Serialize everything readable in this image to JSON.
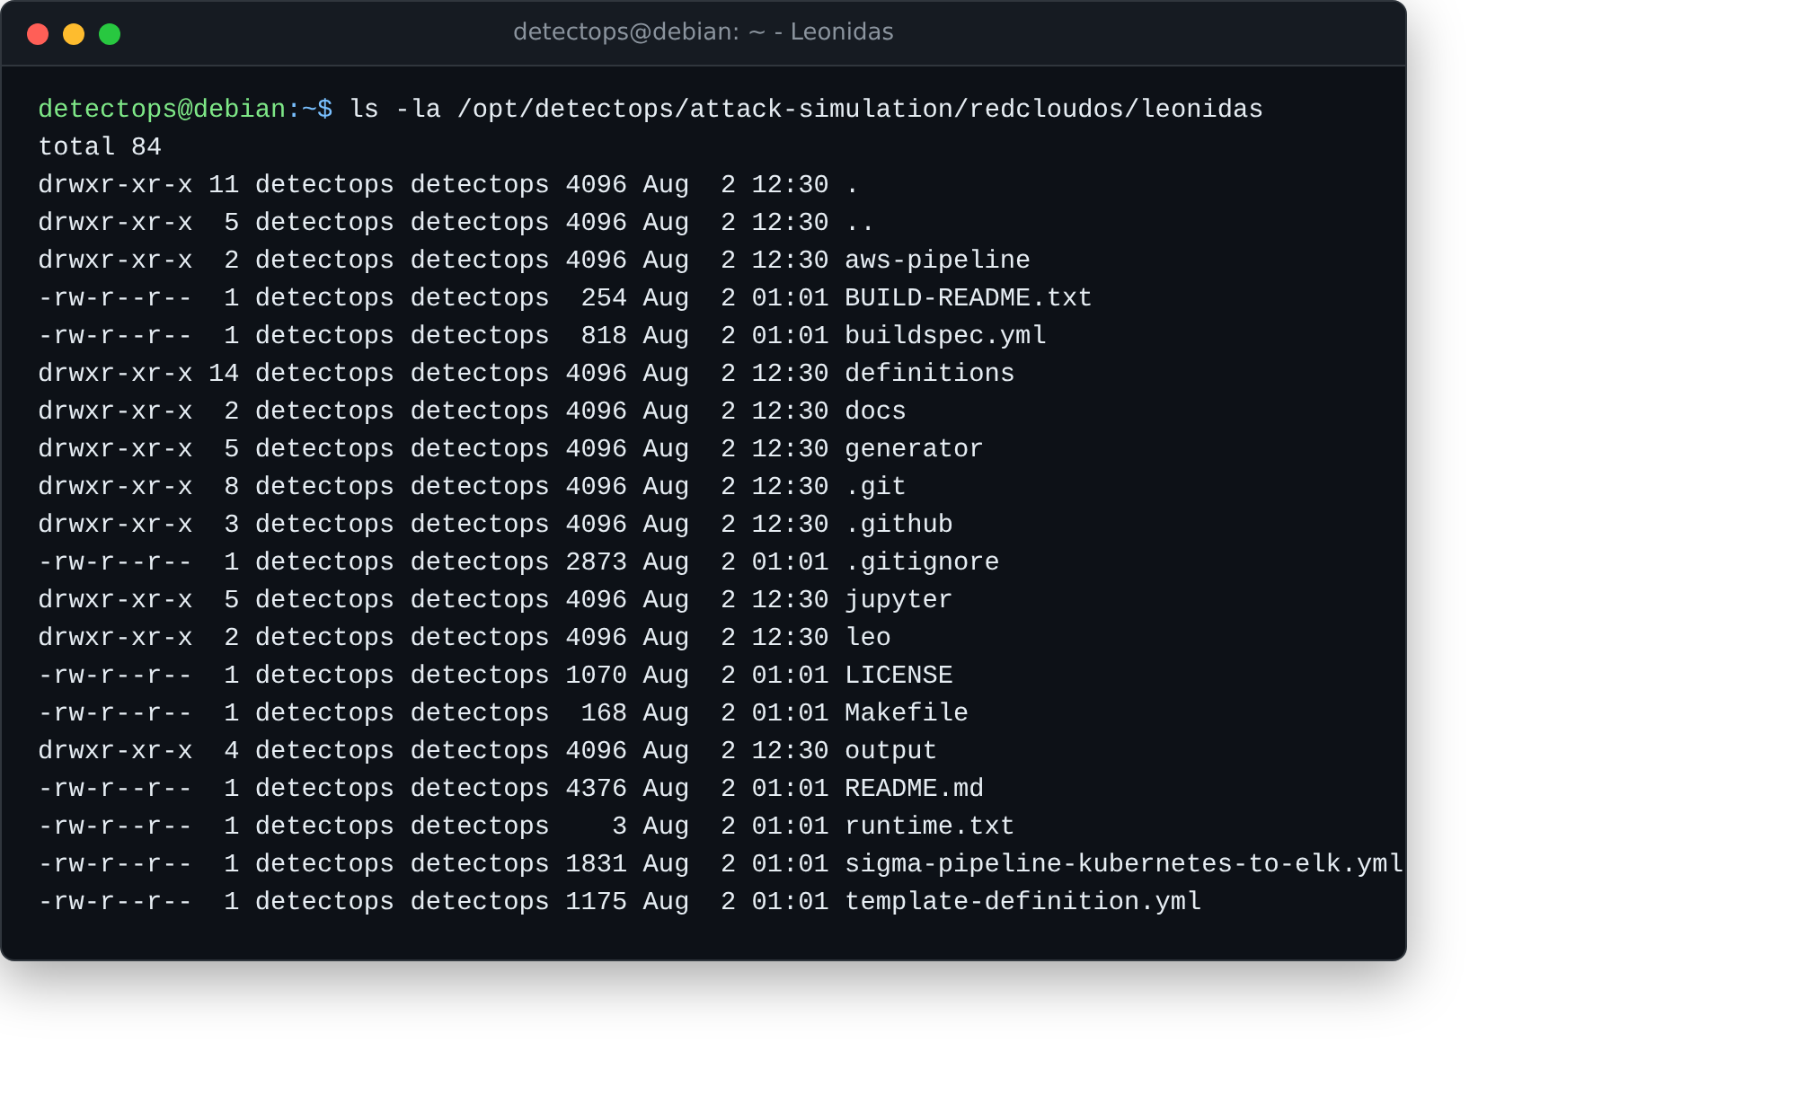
{
  "window": {
    "title": "detectops@debian: ~ - Leonidas",
    "buttons": [
      {
        "color": "#ff5f57"
      },
      {
        "color": "#febc2e"
      },
      {
        "color": "#28c840"
      }
    ]
  },
  "prompt": {
    "user_host": "detectops@debian",
    "path": ":~$",
    "command": "ls -la /opt/detectops/attack-simulation/redcloudos/leonidas"
  },
  "output": [
    "total 84",
    "drwxr-xr-x 11 detectops detectops 4096 Aug  2 12:30 .",
    "drwxr-xr-x  5 detectops detectops 4096 Aug  2 12:30 ..",
    "drwxr-xr-x  2 detectops detectops 4096 Aug  2 12:30 aws-pipeline",
    "-rw-r--r--  1 detectops detectops  254 Aug  2 01:01 BUILD-README.txt",
    "-rw-r--r--  1 detectops detectops  818 Aug  2 01:01 buildspec.yml",
    "drwxr-xr-x 14 detectops detectops 4096 Aug  2 12:30 definitions",
    "drwxr-xr-x  2 detectops detectops 4096 Aug  2 12:30 docs",
    "drwxr-xr-x  5 detectops detectops 4096 Aug  2 12:30 generator",
    "drwxr-xr-x  8 detectops detectops 4096 Aug  2 12:30 .git",
    "drwxr-xr-x  3 detectops detectops 4096 Aug  2 12:30 .github",
    "-rw-r--r--  1 detectops detectops 2873 Aug  2 01:01 .gitignore",
    "drwxr-xr-x  5 detectops detectops 4096 Aug  2 12:30 jupyter",
    "drwxr-xr-x  2 detectops detectops 4096 Aug  2 12:30 leo",
    "-rw-r--r--  1 detectops detectops 1070 Aug  2 01:01 LICENSE",
    "-rw-r--r--  1 detectops detectops  168 Aug  2 01:01 Makefile",
    "drwxr-xr-x  4 detectops detectops 4096 Aug  2 12:30 output",
    "-rw-r--r--  1 detectops detectops 4376 Aug  2 01:01 README.md",
    "-rw-r--r--  1 detectops detectops    3 Aug  2 01:01 runtime.txt",
    "-rw-r--r--  1 detectops detectops 1831 Aug  2 01:01 sigma-pipeline-kubernetes-to-elk.yml",
    "-rw-r--r--  1 detectops detectops 1175 Aug  2 01:01 template-definition.yml"
  ]
}
